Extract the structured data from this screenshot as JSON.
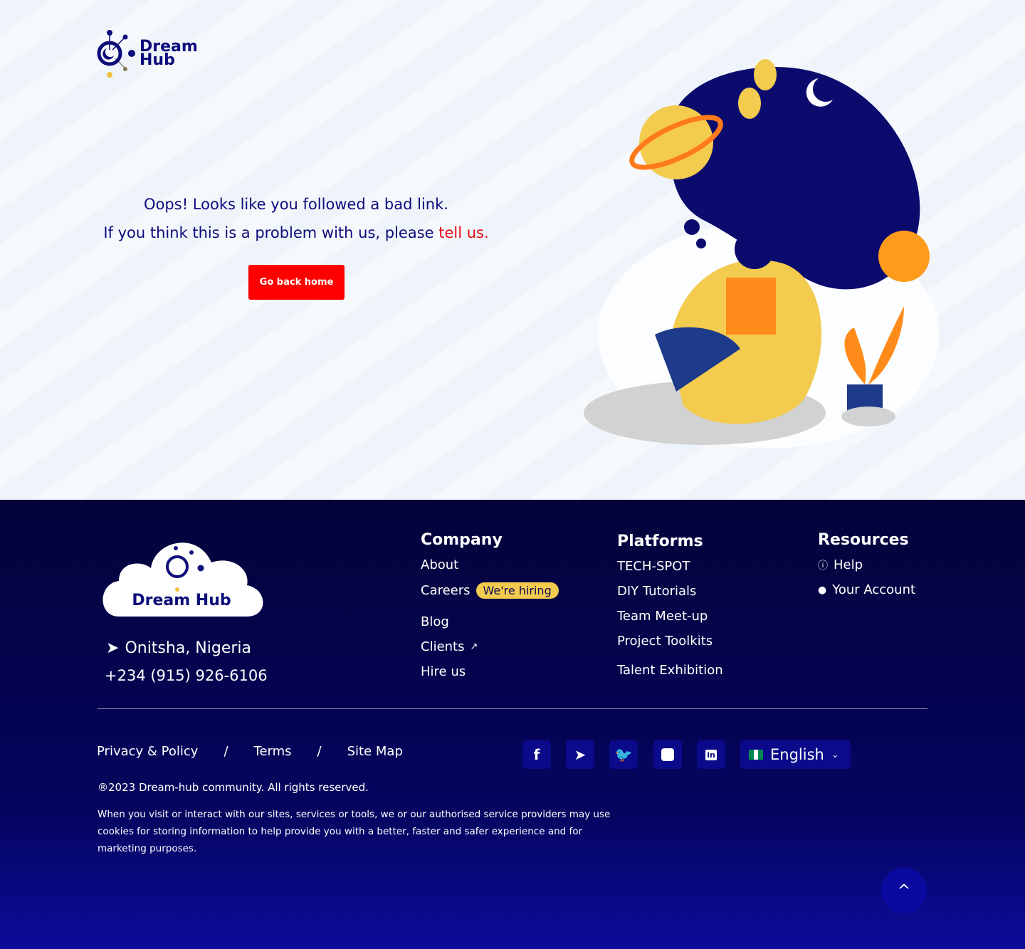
{
  "brand": {
    "name_line1": "Dream",
    "name_line2": "Hub",
    "footer_name": "Dream Hub"
  },
  "error": {
    "line1": "Oops! Looks like you followed a bad link.",
    "line2": "If you think this is a problem with us, please ",
    "link": "tell us.",
    "button": "Go back home"
  },
  "footer": {
    "location": "Onitsha, Nigeria",
    "phone": "+234 (915) 926-6106",
    "company": {
      "title": "Company",
      "items": [
        "About",
        "Careers",
        "Blog",
        "Clients",
        "Hire us"
      ],
      "badge": "We're hiring"
    },
    "platforms": {
      "title": "Platforms",
      "items": [
        "TECH-SPOT",
        "DIY Tutorials",
        "Team Meet-up",
        "Project Toolkits",
        "Talent Exhibition"
      ]
    },
    "resources": {
      "title": "Resources",
      "items": [
        "Help",
        "Your Account"
      ]
    },
    "legal": [
      "Privacy & Policy",
      "/",
      "Terms",
      "/",
      "Site Map"
    ],
    "language": "English",
    "copyright": "®2023 Dream-hub community. All rights reserved.",
    "cookie": "When you visit or interact with our sites, services or tools, we or our authorised service providers may use cookies for storing information to help provide you with a better, faster and safer experience and for marketing purposes."
  },
  "colors": {
    "primary": "#0c0c7a",
    "accent": "#ff0000",
    "footer_bg": "#03033a",
    "badge": "#f3cb4e"
  }
}
